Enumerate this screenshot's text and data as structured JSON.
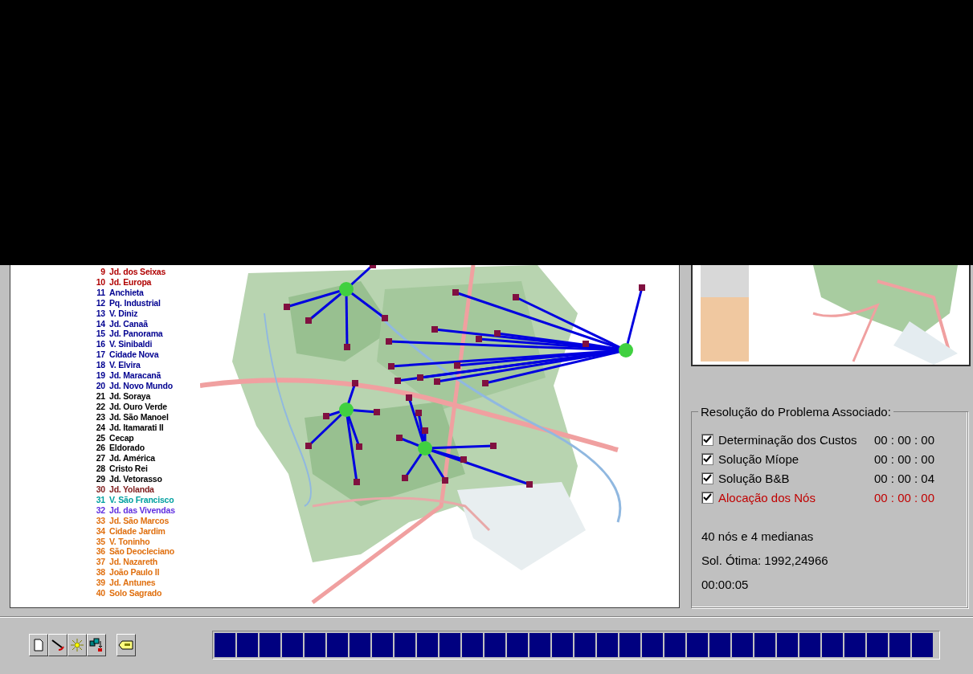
{
  "legend": [
    {
      "number": "9",
      "name": "Jd. dos Seixas",
      "color": "#b00000"
    },
    {
      "number": "10",
      "name": "Jd. Europa",
      "color": "#b00000"
    },
    {
      "number": "11",
      "name": "Anchieta",
      "color": "#000090"
    },
    {
      "number": "12",
      "name": "Pq. Industrial",
      "color": "#000090"
    },
    {
      "number": "13",
      "name": "V. Diniz",
      "color": "#000090"
    },
    {
      "number": "14",
      "name": "Jd. Canaã",
      "color": "#000090"
    },
    {
      "number": "15",
      "name": "Jd. Panorama",
      "color": "#000090"
    },
    {
      "number": "16",
      "name": "V. Sinibaldi",
      "color": "#000090"
    },
    {
      "number": "17",
      "name": "Cidade Nova",
      "color": "#000090"
    },
    {
      "number": "18",
      "name": "V. Elvira",
      "color": "#000090"
    },
    {
      "number": "19",
      "name": "Jd. Maracanã",
      "color": "#000090"
    },
    {
      "number": "20",
      "name": "Jd. Novo Mundo",
      "color": "#000090"
    },
    {
      "number": "21",
      "name": "Jd. Soraya",
      "color": "#000000"
    },
    {
      "number": "22",
      "name": "Jd. Ouro Verde",
      "color": "#000000"
    },
    {
      "number": "23",
      "name": "Jd. São Manoel",
      "color": "#000000"
    },
    {
      "number": "24",
      "name": "Jd. Itamarati II",
      "color": "#000000"
    },
    {
      "number": "25",
      "name": "Cecap",
      "color": "#000000"
    },
    {
      "number": "26",
      "name": "Eldorado",
      "color": "#000000"
    },
    {
      "number": "27",
      "name": "Jd. América",
      "color": "#000000"
    },
    {
      "number": "28",
      "name": "Cristo Rei",
      "color": "#000000"
    },
    {
      "number": "29",
      "name": "Jd. Vetorasso",
      "color": "#000000"
    },
    {
      "number": "30",
      "name": "Jd. Yolanda",
      "color": "#802020"
    },
    {
      "number": "31",
      "name": "V. São Francisco",
      "color": "#00a0a0"
    },
    {
      "number": "32",
      "name": "Jd. das Vivendas",
      "color": "#6030e0"
    },
    {
      "number": "33",
      "name": "Jd. São Marcos",
      "color": "#e07010"
    },
    {
      "number": "34",
      "name": "Cidade Jardim",
      "color": "#e07010"
    },
    {
      "number": "35",
      "name": "V. Toninho",
      "color": "#e07010"
    },
    {
      "number": "36",
      "name": "São Deocleciano",
      "color": "#e07010"
    },
    {
      "number": "37",
      "name": "Jd. Nazareth",
      "color": "#e07010"
    },
    {
      "number": "38",
      "name": "João Paulo II",
      "color": "#e07010"
    },
    {
      "number": "39",
      "name": "Jd. Antunes",
      "color": "#e07010"
    },
    {
      "number": "40",
      "name": "Solo Sagrado",
      "color": "#e07010"
    }
  ],
  "resolution": {
    "title": "Resolução do Problema Associado:",
    "steps": [
      {
        "label": "Determinação dos Custos",
        "time": "00 : 00 : 00",
        "checked": true,
        "highlighted": false
      },
      {
        "label": "Solução Míope",
        "time": "00 : 00 : 00",
        "checked": true,
        "highlighted": false
      },
      {
        "label": "Solução B&B",
        "time": "00 : 00 : 04",
        "checked": true,
        "highlighted": false
      },
      {
        "label": "Alocação dos Nós",
        "time": "00 : 00 : 00",
        "checked": true,
        "highlighted": true
      }
    ],
    "summary": [
      "40 nós e 4 medianas",
      "Sol. Ótima: 1992,24966",
      "00:00:05"
    ]
  },
  "toolbar": {
    "buttons": [
      {
        "kind": "document"
      },
      {
        "kind": "pen"
      },
      {
        "kind": "sun"
      },
      {
        "kind": "shapes"
      }
    ],
    "tag_button": {
      "kind": "tag"
    }
  },
  "progress": {
    "level": 1
  }
}
